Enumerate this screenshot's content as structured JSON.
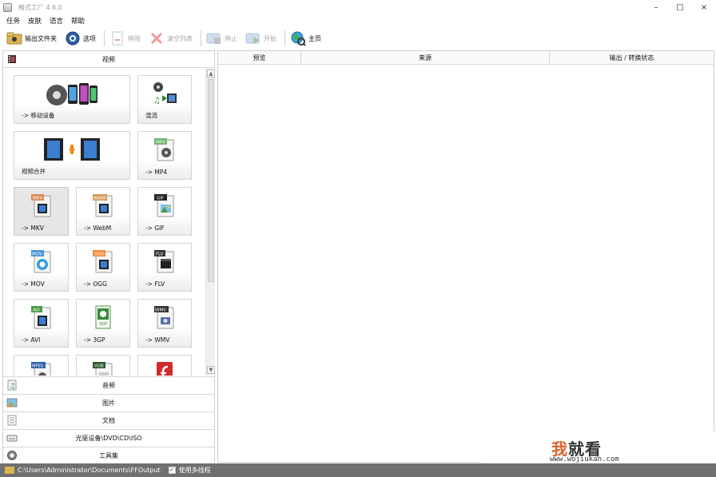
{
  "window": {
    "title": "格式工厂 4.6.0",
    "controls": [
      "–",
      "□",
      "×"
    ]
  },
  "menu": [
    "任务",
    "皮肤",
    "语言",
    "帮助"
  ],
  "toolbar": {
    "output_folder": "输出文件夹",
    "options": "选项",
    "remove": "移除",
    "clear_list": "清空列表",
    "stop": "停止",
    "start": "开始",
    "home": "主页"
  },
  "categories": {
    "video": "视频",
    "audio": "音频",
    "picture": "图片",
    "document": "文档",
    "rom": "光驱设备\\DVD\\CD\\ISO",
    "tools": "工具集"
  },
  "video_tiles": [
    "-> 移动设备",
    "混流",
    "视频合并",
    "-> MP4",
    "-> MKV",
    "-> WebM",
    "-> GIF",
    "-> MOV",
    "-> OGG",
    "-> FLV",
    "-> AVI",
    "-> 3GP",
    "-> WMV",
    "",
    "",
    ""
  ],
  "tile_badges": {
    "mp4": "MP4",
    "mkv": "MKV",
    "webm": "WebM",
    "gif": "GIF",
    "mov": "MOV",
    "ogg": "OGG",
    "flv": "FLV",
    "avi": "AVI",
    "gp3": "3GP",
    "wmv": "WMV",
    "mpeg": "MPEG",
    "vob": "VOB"
  },
  "table": {
    "columns": [
      "预览",
      "来源",
      "输出 / 转换状态"
    ]
  },
  "watermark": {
    "first": "我",
    "rest": "就看",
    "url": "www.wojiukan.com"
  },
  "statusbar": {
    "output_path": "C:\\Users\\Administrator\\Documents\\FFOutput",
    "multithread_label": "使用多线程",
    "multithread_checked": "✓"
  },
  "colors": {
    "accent_orange": "#e0612d",
    "statusbar_bg": "#707070"
  }
}
